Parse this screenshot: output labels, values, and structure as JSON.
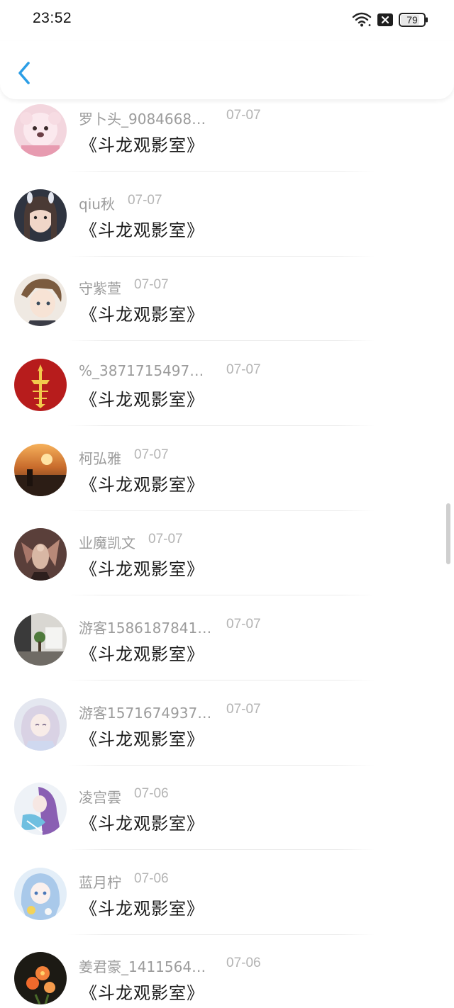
{
  "status_bar": {
    "time": "23:52",
    "battery": "79",
    "icons": [
      "wifi-icon",
      "no-sim-icon",
      "battery-icon"
    ]
  },
  "nav": {
    "back_icon": "chevron-left-icon",
    "accent_color": "#2b9ee6"
  },
  "comments": [
    {
      "nickname": "罗卜头_90846684...",
      "date": "07-07",
      "content": "《斗龙观影室》",
      "avatar": "pink-bear-avatar"
    },
    {
      "nickname": "qiu秋",
      "date": "07-07",
      "content": "《斗龙观影室》",
      "avatar": "girl-photo-avatar"
    },
    {
      "nickname": "守紫萱",
      "date": "07-07",
      "content": "《斗龙观影室》",
      "avatar": "anime-boy-avatar"
    },
    {
      "nickname": "%_387171549736...",
      "date": "07-07",
      "content": "《斗龙观影室》",
      "avatar": "red-emblem-avatar"
    },
    {
      "nickname": "柯弘雅",
      "date": "07-07",
      "content": "《斗龙观影室》",
      "avatar": "sunset-avatar"
    },
    {
      "nickname": "业魔凯文",
      "date": "07-07",
      "content": "《斗龙观影室》",
      "avatar": "game-character-avatar"
    },
    {
      "nickname": "游客15861878419...",
      "date": "07-07",
      "content": "《斗龙观影室》",
      "avatar": "room-photo-avatar"
    },
    {
      "nickname": "游客15716749376...",
      "date": "07-07",
      "content": "《斗龙观影室》",
      "avatar": "anime-girl-avatar"
    },
    {
      "nickname": "凌宫雲",
      "date": "07-06",
      "content": "《斗龙观影室》",
      "avatar": "purple-anime-avatar"
    },
    {
      "nickname": "蓝月柠",
      "date": "07-06",
      "content": "《斗龙观影室》",
      "avatar": "blue-anime-avatar"
    },
    {
      "nickname": "姜君豪_14115640...",
      "date": "07-06",
      "content": "《斗龙观影室》",
      "avatar": "flower-avatar"
    }
  ]
}
